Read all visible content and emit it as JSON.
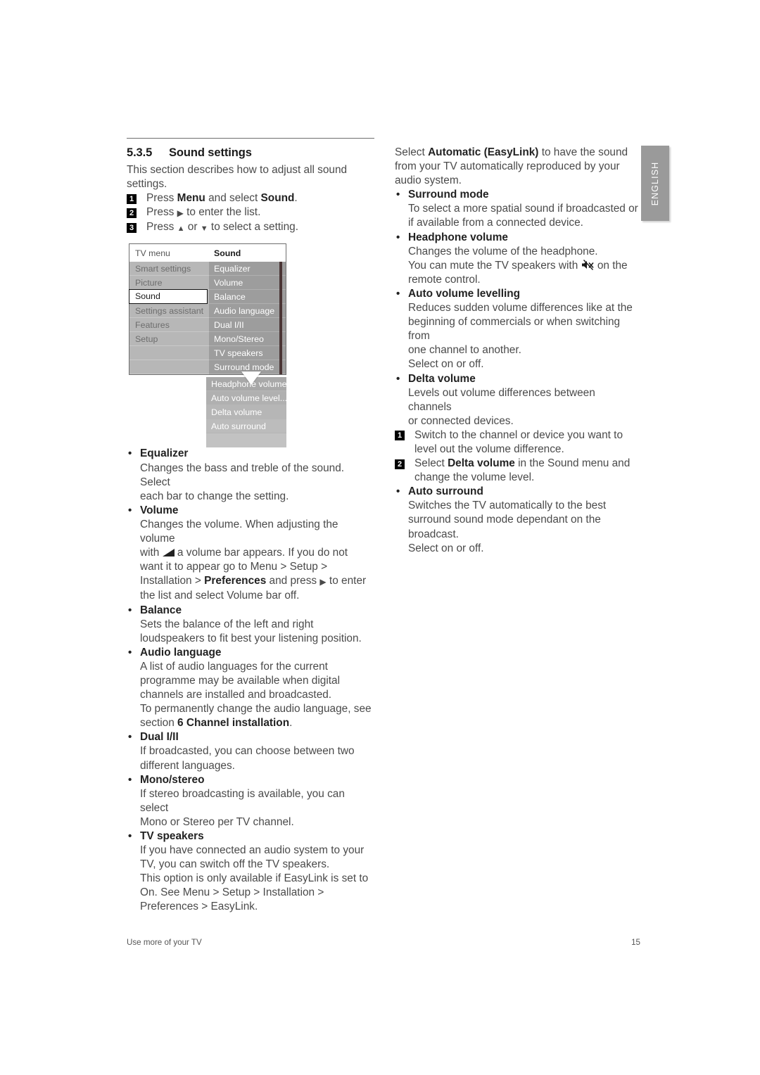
{
  "page": {
    "language_tab": "ENGLISH",
    "footer_left": "Use more of your TV",
    "footer_page_number": "15"
  },
  "section": {
    "number": "5.3.5",
    "title": "Sound settings",
    "intro": "This section describes how to adjust all sound settings.",
    "steps": [
      {
        "num": "1",
        "text_before": "Press ",
        "bold1": "Menu",
        "text_mid": " and select ",
        "bold2": "Sound",
        "text_after": "."
      },
      {
        "num": "2",
        "text_before": "Press ",
        "glyph": "▶",
        "text_after": " to enter the list."
      },
      {
        "num": "3",
        "text_before": "Press ",
        "glyph": "▲",
        "text_mid": " or ",
        "glyph2": "▼",
        "text_after": " to select a setting."
      }
    ]
  },
  "tv_menu": {
    "header_left": "TV menu",
    "header_right": "Sound",
    "left_items": [
      {
        "label": "Smart settings",
        "selected": false
      },
      {
        "label": "Picture",
        "selected": false
      },
      {
        "label": "Sound",
        "selected": true
      },
      {
        "label": "Settings assistant",
        "selected": false
      },
      {
        "label": "Features",
        "selected": false
      },
      {
        "label": "Setup",
        "selected": false
      },
      {
        "label": "",
        "selected": false
      },
      {
        "label": "",
        "selected": false
      }
    ],
    "right_items": [
      "Equalizer",
      "Volume",
      "Balance",
      "Audio language",
      "Dual I/II",
      "Mono/Stereo",
      "TV speakers",
      "Surround mode"
    ],
    "overflow_items": [
      "Headphone volume",
      "Auto volume level...",
      "Delta volume",
      "Auto surround",
      ""
    ]
  },
  "left_column": {
    "entries": [
      {
        "title": "Equalizer",
        "lines": [
          "Changes the bass and treble of the sound. Select",
          "each bar to change the setting."
        ]
      },
      {
        "title": "Volume",
        "volume_html": true,
        "lines": [
          "Changes the volume. When adjusting the volume",
          "with ◢ a volume bar appears. If you do not",
          "want it to appear go to Menu > Setup >",
          "Installation > Preferences and press ▶ to enter",
          "the list and select Volume bar off."
        ]
      },
      {
        "title": "Balance",
        "lines": [
          "Sets the balance of the left and right",
          "loudspeakers to fit best your listening position."
        ]
      },
      {
        "title": "Audio language",
        "lines": [
          "A list of audio languages for the current",
          "programme may be available when digital",
          "channels are installed and broadcasted.",
          "To permanently change the audio language, see",
          "section 6 Channel installation."
        ]
      },
      {
        "title": "Dual I/II",
        "lines": [
          "If broadcasted, you can choose between two",
          "different languages."
        ]
      },
      {
        "title": "Mono/stereo",
        "lines": [
          "If stereo broadcasting is available, you can select",
          "Mono or Stereo per TV channel."
        ]
      },
      {
        "title": "TV speakers",
        "lines": [
          "If you have connected an audio system to your",
          "TV, you can switch off the TV speakers.",
          "This option is only available if EasyLink is set to",
          "On. See Menu > Setup > Installation >",
          "Preferences > EasyLink."
        ]
      }
    ]
  },
  "right_column": {
    "lead": {
      "part1": "Select ",
      "bold": "Automatic (EasyLink)",
      "part2": " to have the sound from your TV automatically reproduced by your audio system."
    },
    "entries": [
      {
        "title": "Surround mode",
        "lines": [
          "To select a more spatial sound if broadcasted or",
          "if available from a connected device."
        ]
      },
      {
        "title": "Headphone volume",
        "lines": [
          "Changes the volume of the headphone.",
          "You can mute the TV speakers with   on the",
          "remote control."
        ]
      },
      {
        "title": "Auto volume levelling",
        "lines": [
          "Reduces sudden volume differences like at the",
          "beginning of commercials or when switching from",
          "one channel to another.",
          "Select on or off."
        ]
      },
      {
        "title": "Delta volume",
        "lines": [
          "Levels out volume differences between channels",
          "or connected devices."
        ]
      },
      {
        "title": "Auto surround",
        "lines": [
          "Switches the TV automatically to the best",
          "surround sound mode dependant on the",
          "broadcast.",
          "Select on or off."
        ]
      }
    ],
    "delta_steps": [
      {
        "num": "1",
        "text": "Switch to the channel or device you want to level out the volume difference."
      },
      {
        "num": "2",
        "pre": "Select ",
        "bold": "Delta volume",
        "post": " in the Sound menu and change the volume level."
      }
    ]
  },
  "labels": {
    "equalizer": "Equalizer",
    "volume": "Volume",
    "balance": "Balance",
    "audio_language": "Audio language",
    "dual": "Dual I/II",
    "mono_stereo": "Mono/stereo",
    "tv_speakers": "TV speakers",
    "surround_mode": "Surround mode",
    "headphone_volume": "Headphone volume",
    "auto_volume_levelling": "Auto volume levelling",
    "delta_volume": "Delta volume",
    "auto_surround": "Auto surround"
  }
}
